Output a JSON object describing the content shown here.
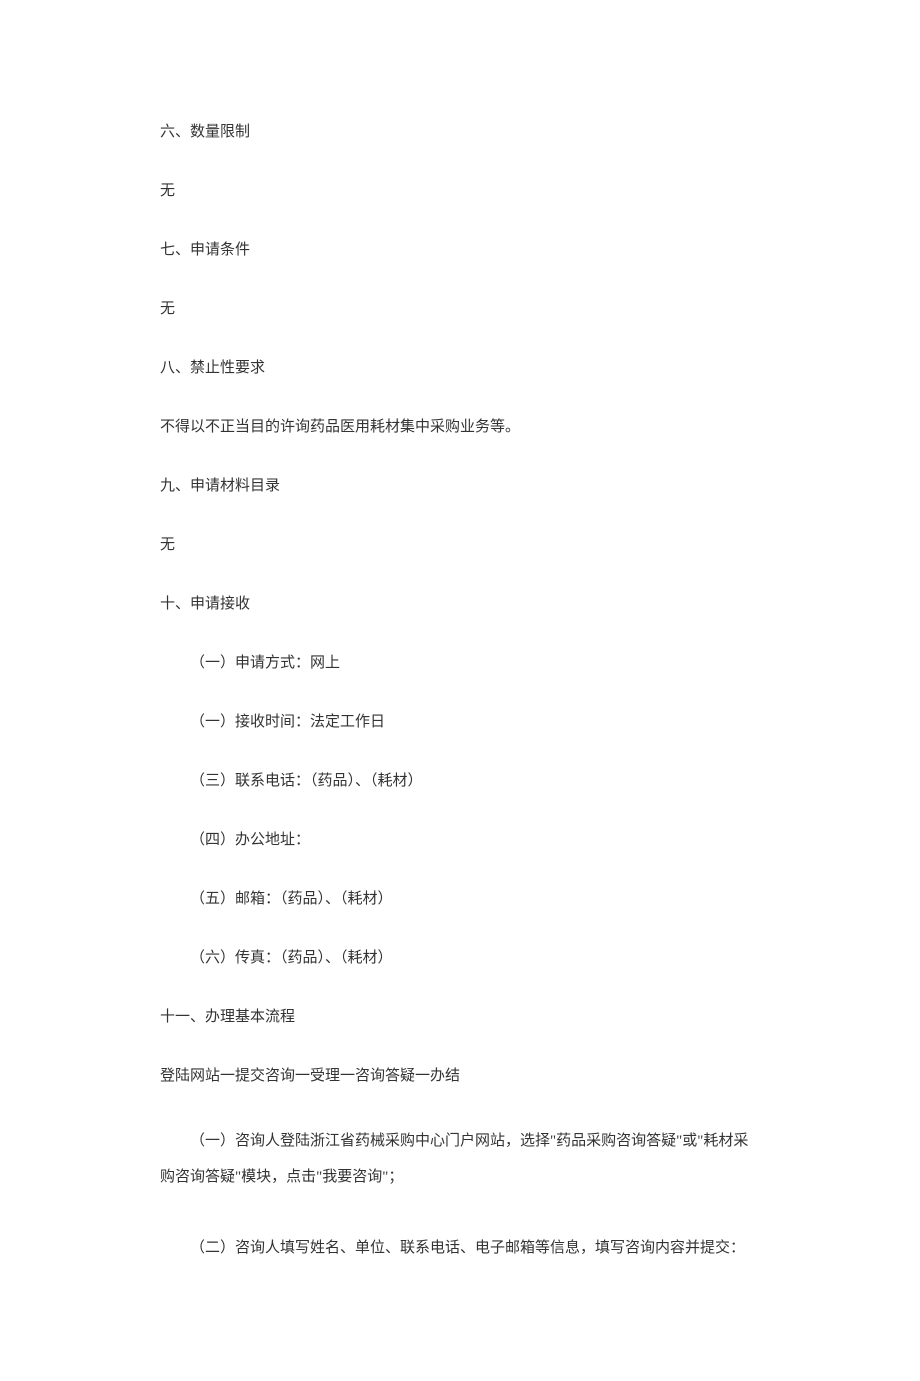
{
  "sections": {
    "six": {
      "heading": "六、数量限制",
      "content": "无"
    },
    "seven": {
      "heading": "七、申请条件",
      "content": "无"
    },
    "eight": {
      "heading": "八、禁止性要求",
      "content": "不得以不正当目的许询药品医用耗材集中采购业务等。"
    },
    "nine": {
      "heading": "九、申请材料目录",
      "content": "无"
    },
    "ten": {
      "heading": "十、申请接收",
      "items": {
        "one": "（一）申请方式：网上",
        "two": "（一）接收时间：法定工作日",
        "three": "（三）联系电话：（药品）、（耗材）",
        "four": "（四）办公地址：",
        "five": "（五）邮箱：（药品）、（耗材）",
        "six": "（六）传真：（药品）、（耗材）"
      }
    },
    "eleven": {
      "heading": "十一、办理基本流程",
      "flow": "登陆网站一提交咨询一受理一咨询答疑一办结",
      "steps": {
        "one": "（一）咨询人登陆浙江省药械采购中心门户网站，选择\"药品采购咨询答疑\"或\"耗材采购咨询答疑\"模块，点击\"我要咨询\"；",
        "two": "（二）咨询人填写姓名、单位、联系电话、电子邮箱等信息，填写咨询内容并提交："
      }
    }
  }
}
